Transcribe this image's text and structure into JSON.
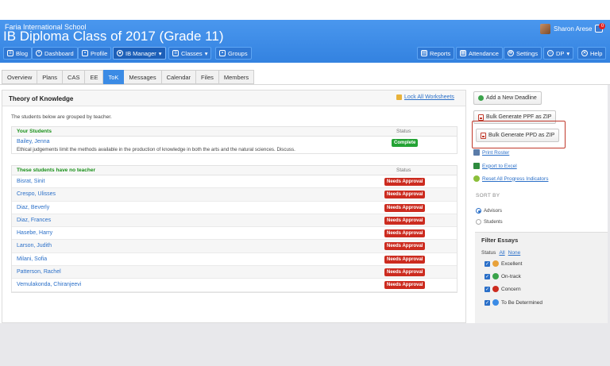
{
  "header": {
    "school": "Faria International School",
    "title": "IB Diploma Class of 2017 (Grade 11)",
    "user_name": "Sharon Arese",
    "notification_count": "0"
  },
  "nav": {
    "left": [
      {
        "label": "Blog",
        "icon": "blog-icon"
      },
      {
        "label": "Dashboard",
        "icon": "dashboard-icon"
      },
      {
        "label": "Profile",
        "icon": "profile-icon"
      },
      {
        "label": "IB Manager",
        "icon": "ib-manager-icon",
        "active": true
      },
      {
        "label": "Classes",
        "icon": "classes-icon"
      },
      {
        "label": "Groups",
        "icon": "groups-icon"
      }
    ],
    "right": [
      {
        "label": "Reports",
        "icon": "reports-icon"
      },
      {
        "label": "Attendance",
        "icon": "attendance-icon"
      },
      {
        "label": "Settings",
        "icon": "settings-icon"
      },
      {
        "label": "DP",
        "icon": "search-icon"
      },
      {
        "label": "Help",
        "icon": "help-icon"
      }
    ]
  },
  "tabs": [
    "Overview",
    "Plans",
    "CAS",
    "EE",
    "ToK",
    "Messages",
    "Calendar",
    "Files",
    "Members"
  ],
  "active_tab": "ToK",
  "main": {
    "title": "Theory of Knowledge",
    "lock_link": "Lock All Worksheets",
    "grouped_note": "The students below are grouped by teacher.",
    "your_students": {
      "title": "Your Students",
      "status_header": "Status",
      "student": "Bailey, Jenna",
      "description": "Ethical judgements limit the methods available in the production of knowledge in both the arts and the natural sciences. Discuss.",
      "status": "Complete"
    },
    "no_teacher": {
      "title": "These students have no teacher",
      "status_header": "Status",
      "rows": [
        {
          "name": "Bisrat, Sinit",
          "status": "Needs Approval"
        },
        {
          "name": "Crespo, Ulisses",
          "status": "Needs Approval"
        },
        {
          "name": "Diaz, Beverly",
          "status": "Needs Approval"
        },
        {
          "name": "Diaz, Frances",
          "status": "Needs Approval"
        },
        {
          "name": "Hasebe, Harry",
          "status": "Needs Approval"
        },
        {
          "name": "Larson, Judith",
          "status": "Needs Approval"
        },
        {
          "name": "Milani, Sofia",
          "status": "Needs Approval"
        },
        {
          "name": "Patterson, Rachel",
          "status": "Needs Approval"
        },
        {
          "name": "Vemulakonda, Chiranjeevi",
          "status": "Needs Approval"
        }
      ]
    }
  },
  "sidebar": {
    "add_deadline": "Add a New Deadline",
    "bulk_ppf": "Bulk Generate PPF as ZIP",
    "bulk_ppd": "Bulk Generate PPD as ZIP",
    "print_roster": "Print Roster",
    "export_excel": "Export to Excel",
    "reset_progress": "Reset All Progress Indicators",
    "sort_by": "SORT BY",
    "sort_options": [
      {
        "label": "Advisors",
        "selected": true
      },
      {
        "label": "Students",
        "selected": false
      }
    ],
    "filter_title": "Filter Essays",
    "filter_status_label": "Status",
    "filter_all": "All",
    "filter_none": "None",
    "filters": [
      {
        "label": "Excellent",
        "icon": "trophy-icon",
        "color": "#e8a23a"
      },
      {
        "label": "On-track",
        "icon": "flag-icon",
        "color": "#3aa34a"
      },
      {
        "label": "Concern",
        "icon": "flag-icon",
        "color": "#cc2b1f"
      },
      {
        "label": "To Be Determined",
        "icon": "question-icon",
        "color": "#3b8be5"
      }
    ]
  },
  "colors": {
    "header": "#3a8be8",
    "complete": "#23a334",
    "needs_approval": "#cc2b1f",
    "link": "#2a6fc8",
    "section_title": "#199019"
  }
}
